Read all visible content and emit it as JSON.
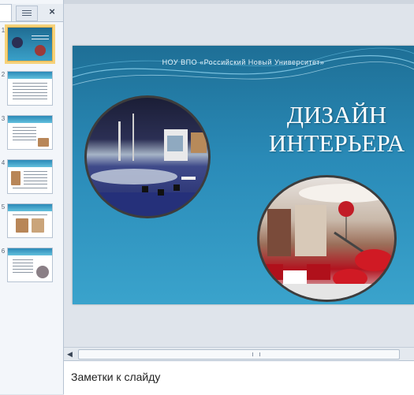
{
  "thumbnails_pane": {
    "close_glyph": "×",
    "slide_numbers": [
      "1",
      "2",
      "3",
      "4",
      "5",
      "6"
    ]
  },
  "slide": {
    "organization": "НОУ ВПО «Российский Новый Университет»",
    "title_line1": "ДИЗАЙН",
    "title_line2": "ИНТЕРЬЕРА"
  },
  "notes": {
    "placeholder": "Заметки к слайду"
  },
  "colors": {
    "slide_top": "#1e6f96",
    "slide_bottom": "#3aa3cc",
    "selection": "#f6d27a"
  }
}
